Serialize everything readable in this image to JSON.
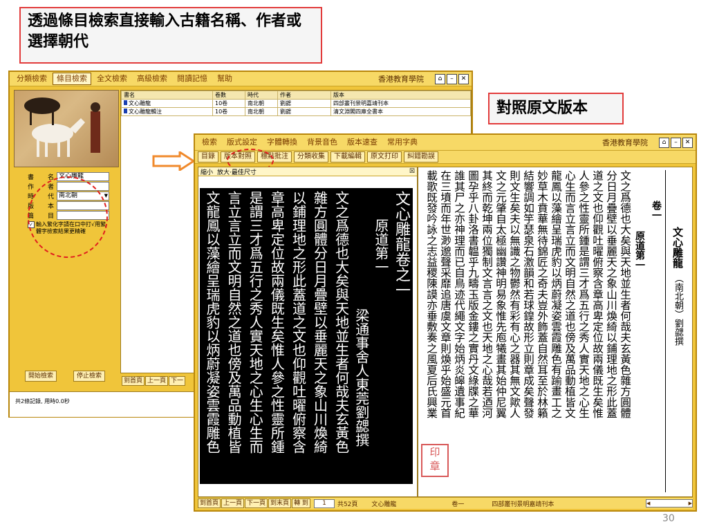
{
  "callouts": {
    "top": "透過條目檢索直接輸入古籍名稱、作者或選擇朝代",
    "right": "對照原文版本"
  },
  "slide_number": "30",
  "back_window": {
    "menu": [
      "分類檢索",
      "條目檢索",
      "全文檢索",
      "高級檢索",
      "閱讀記憶",
      "幫助"
    ],
    "selected_menu": "條目檢索",
    "brand": "香港教育學院",
    "form": {
      "fields": [
        {
          "label_a": "書",
          "label_b": "名",
          "value": "文心雕龍"
        },
        {
          "label_a": "作",
          "label_b": "者",
          "value": ""
        },
        {
          "label_a": "時",
          "label_b": "代",
          "value": "南北朝"
        },
        {
          "label_a": "版",
          "label_b": "本",
          "value": ""
        },
        {
          "label_a": "篇",
          "label_b": "目",
          "value": ""
        }
      ],
      "checkbox_label": "輸入繁化字請在口中打√用繁體字檢索結果更精確"
    },
    "start_button": "開始檢索",
    "stop_button": "停止檢索",
    "nav": [
      "到首頁",
      "上一頁",
      "下一"
    ],
    "status": "共2條記錄, 用時0.0秒",
    "table": {
      "headers": [
        "書名",
        "卷數",
        "時代",
        "作者",
        "版本"
      ],
      "rows": [
        [
          "文心雕龍",
          "10卷",
          "南北朝",
          "劉勰",
          "四部叢刊景明嘉靖刊本"
        ],
        [
          "文心雕龍輯注",
          "10卷",
          "南北朝",
          "劉勰",
          "清文淵閣四庫全書本"
        ]
      ]
    }
  },
  "front_window": {
    "menu": [
      "檢索",
      "版式設定",
      "字體轉換",
      "背景音色",
      "版本速查",
      "常用字典"
    ],
    "brand": "香港教育學院",
    "toolbar": [
      "目錄",
      "版本對照",
      "標點批注",
      "分類收集",
      "下載編輯",
      "原文打印",
      "糾錯勘誤"
    ],
    "image_pane": {
      "zoom_out": "縮小",
      "zoom_fit": "放大·最佳尺寸",
      "close": "☒",
      "title_col": "文心雕龍卷之一",
      "chapter_col": "原道第一",
      "author_col": "梁通事舍人東莞劉勰撰",
      "body_cols": [
        "文之爲德也大矣與天地並生者何哉夫玄黃色",
        "雜方圓體分日月疊壁以垂麗天之象山川煥綺",
        "以鋪理地之形此蓋道之文也仰觀吐曜俯察含",
        "章高卑定位故兩儀既生矣惟人參之性靈所鍾",
        "是謂三才爲五行之秀人實天地之心生心生而",
        "言立言立而文明自然之道也傍及萬品動植皆",
        "文龍鳳以藻繪呈瑞虎豹以炳蔚凝姿雲霞雕色"
      ]
    },
    "text_pane": {
      "header_cols": [
        "文心雕龍",
        "（南北朝）劉勰撰"
      ],
      "juan": "卷一",
      "chapter": "原道第一",
      "cols": [
        "文之爲德也大矣與天地並生者何哉夫玄黃色雜方圓體",
        "分日月疊壁以垂麗天之象山川煥綺以鋪理地之形此蓋",
        "道之文也仰觀吐曜俯察含章高卑定位故兩儀既生矣惟",
        "人參之性靈所鍾是謂三才爲五行之秀人實天地之心生",
        "心生而言立言立而文明自然之道也傍及萬品動植皆文",
        "龍鳳以藻繪呈瑞虎豹以炳蔚凝姿雲霞雕色有踰畫工之",
        "妙草木賁華無待錦匠之奇夫豈外飾蓋自然耳至於林籟",
        "結響調如竽瑟泉石激韻和若球鍠故形立則章成矣聲發",
        "則文生矣夫以無識之物鬱然有彩有心之器其無文歟人",
        "文之元肇自太極幽讚神明易象惟先庖犧畫其始仲尼翼",
        "其終而乾坤兩位獨制文言言之文也天地之心哉若迺河",
        "圖孕乎八卦洛書韞乎九疇玉版金鏤之實丹文綠牒之華",
        "誰其尸之亦神理而已自鳥迹代繩文字始炳炎皞遺事紀",
        "在三墳而年世渺邈聲采靡追唐虞文章則煥乎始盛元首",
        "載歌既發吟詠之志益稷陳謨亦垂敷奏之風夏后氏興業"
      ]
    },
    "statusbar": [
      "到首頁",
      "上一頁",
      "下一頁",
      "到末頁",
      "轉 到",
      "1",
      "共52頁",
      "文心雕龍",
      "卷一",
      "四部叢刊景明嘉靖刊本"
    ]
  },
  "colors": {
    "window_bg": "#f0c53a",
    "callout_border": "#e23b3b",
    "highlight_ellipse": "#e01e1e",
    "arrow": "#f08a2c"
  }
}
